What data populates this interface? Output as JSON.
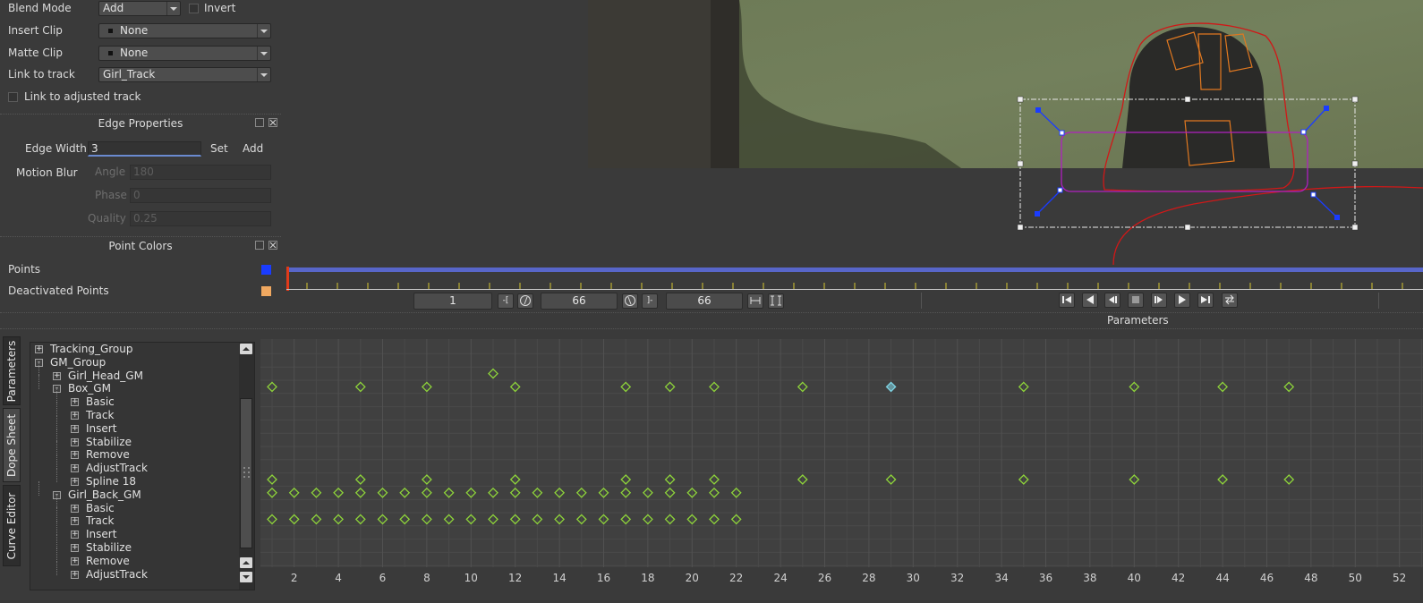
{
  "left_panel": {
    "blend_mode_label": "Blend Mode",
    "blend_mode_value": "Add",
    "invert_label": "Invert",
    "insert_clip_label": "Insert Clip",
    "insert_clip_value": "None",
    "matte_clip_label": "Matte Clip",
    "matte_clip_value": "None",
    "link_to_track_label": "Link to track",
    "link_to_track_value": "Girl_Track",
    "link_adjusted_label": "Link to adjusted track"
  },
  "edge_properties": {
    "title": "Edge Properties",
    "edge_width_label": "Edge Width",
    "edge_width_value": "3",
    "set_label": "Set",
    "add_label": "Add",
    "motion_blur_label": "Motion Blur",
    "angle_label": "Angle",
    "angle_value": "180",
    "phase_label": "Phase",
    "phase_value": "0",
    "quality_label": "Quality",
    "quality_value": "0.25"
  },
  "point_colors": {
    "title": "Point Colors",
    "points_label": "Points",
    "points_color": "#1a3cff",
    "deactivated_label": "Deactivated Points",
    "deactivated_color": "#f0a860"
  },
  "timeline": {
    "start_frame": "1",
    "current_frame": "66",
    "end_frame": "66",
    "parameters_label": "Parameters"
  },
  "side_tabs": {
    "parameters": "Parameters",
    "dope_sheet": "Dope Sheet",
    "curve_editor": "Curve Editor"
  },
  "tree": [
    {
      "label": "Tracking_Group",
      "depth": 0,
      "expander": "+"
    },
    {
      "label": "GM_Group",
      "depth": 0,
      "expander": "-"
    },
    {
      "label": "Girl_Head_GM",
      "depth": 1,
      "expander": "+"
    },
    {
      "label": "Box_GM",
      "depth": 1,
      "expander": "-"
    },
    {
      "label": "Basic",
      "depth": 2,
      "expander": "+"
    },
    {
      "label": "Track",
      "depth": 2,
      "expander": "+"
    },
    {
      "label": "Insert",
      "depth": 2,
      "expander": "+"
    },
    {
      "label": "Stabilize",
      "depth": 2,
      "expander": "+"
    },
    {
      "label": "Remove",
      "depth": 2,
      "expander": "+"
    },
    {
      "label": "AdjustTrack",
      "depth": 2,
      "expander": "+"
    },
    {
      "label": "Spline 18",
      "depth": 2,
      "expander": "+"
    },
    {
      "label": "Girl_Back_GM",
      "depth": 1,
      "expander": "-"
    },
    {
      "label": "Basic",
      "depth": 2,
      "expander": "+"
    },
    {
      "label": "Track",
      "depth": 2,
      "expander": "+"
    },
    {
      "label": "Insert",
      "depth": 2,
      "expander": "+"
    },
    {
      "label": "Stabilize",
      "depth": 2,
      "expander": "+"
    },
    {
      "label": "Remove",
      "depth": 2,
      "expander": "+"
    },
    {
      "label": "AdjustTrack",
      "depth": 2,
      "expander": "+"
    }
  ],
  "dope_sheet": {
    "x_axis_labels": [
      "2",
      "4",
      "6",
      "8",
      "10",
      "12",
      "14",
      "16",
      "18",
      "20",
      "22",
      "24",
      "26",
      "28",
      "30",
      "32",
      "34",
      "36",
      "38",
      "40",
      "42",
      "44",
      "46",
      "48",
      "50",
      "52"
    ],
    "keyframe_rows": [
      {
        "row": 2,
        "frames": [
          11
        ]
      },
      {
        "row": 3,
        "frames": [
          1,
          5,
          8,
          12,
          17,
          19,
          21,
          25,
          29,
          35,
          40,
          44,
          47
        ],
        "selected": [
          29
        ]
      },
      {
        "row": 10,
        "frames": [
          1,
          5,
          8,
          12,
          17,
          19,
          21,
          25,
          29,
          35,
          40,
          44,
          47
        ]
      },
      {
        "row": 11,
        "frames": [
          1,
          2,
          3,
          4,
          5,
          6,
          7,
          8,
          9,
          10,
          11,
          12,
          13,
          14,
          15,
          16,
          17,
          18,
          19,
          20,
          21,
          22
        ]
      },
      {
        "row": 13,
        "frames": [
          1,
          2,
          3,
          4,
          5,
          6,
          7,
          8,
          9,
          10,
          11,
          12,
          13,
          14,
          15,
          16,
          17,
          18,
          19,
          20,
          21,
          22
        ]
      }
    ],
    "key_color": "#8ed43a",
    "selected_key_color": "#7fd6e6"
  }
}
